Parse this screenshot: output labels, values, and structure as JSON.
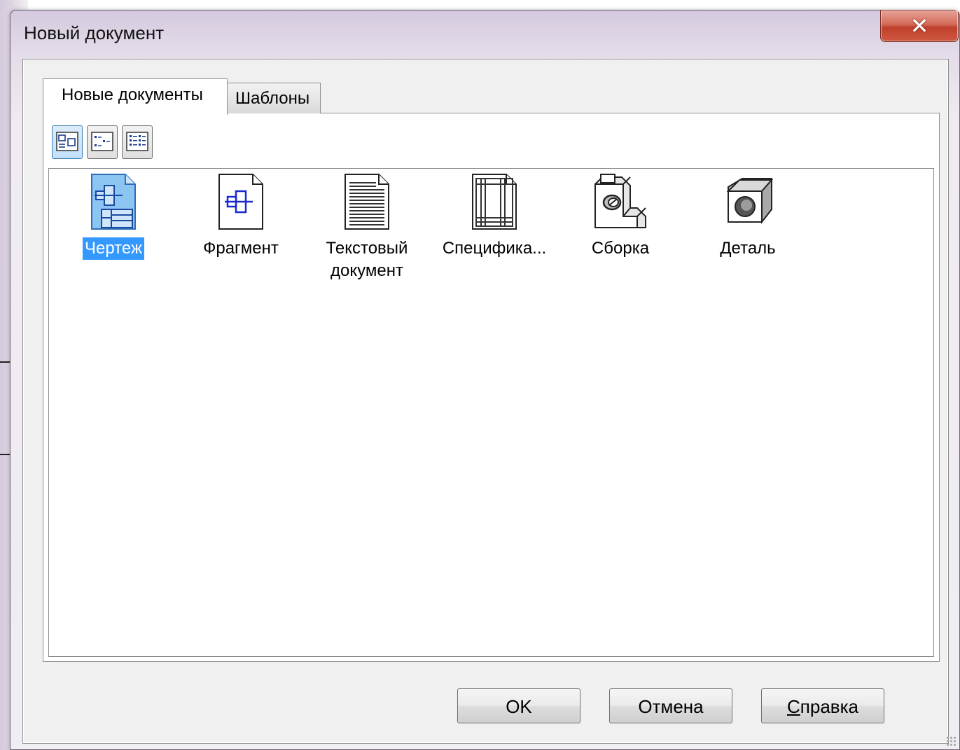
{
  "window": {
    "title": "Новый документ",
    "close_glyph": "✕"
  },
  "tabs": [
    {
      "label": "Новые документы",
      "active": true
    },
    {
      "label": "Шаблоны",
      "active": false
    }
  ],
  "view_buttons": [
    {
      "icon": "large-icons-view-icon",
      "active": true
    },
    {
      "icon": "small-icons-view-icon",
      "active": false
    },
    {
      "icon": "list-view-icon",
      "active": false
    }
  ],
  "documents": [
    {
      "label": "Чертеж",
      "icon": "drawing-icon",
      "selected": true
    },
    {
      "label": "Фрагмент",
      "icon": "fragment-icon",
      "selected": false
    },
    {
      "label": "Текстовый документ",
      "icon": "text-document-icon",
      "selected": false
    },
    {
      "label": "Специфика...",
      "icon": "specification-icon",
      "selected": false
    },
    {
      "label": "Сборка",
      "icon": "assembly-icon",
      "selected": false
    },
    {
      "label": "Деталь",
      "icon": "part-icon",
      "selected": false
    }
  ],
  "buttons": {
    "ok": "OK",
    "cancel": "Отмена",
    "help_mnemonic": "С",
    "help_rest": "правка"
  },
  "colors": {
    "selection": "#3399ff",
    "close_button": "#c8422e"
  }
}
